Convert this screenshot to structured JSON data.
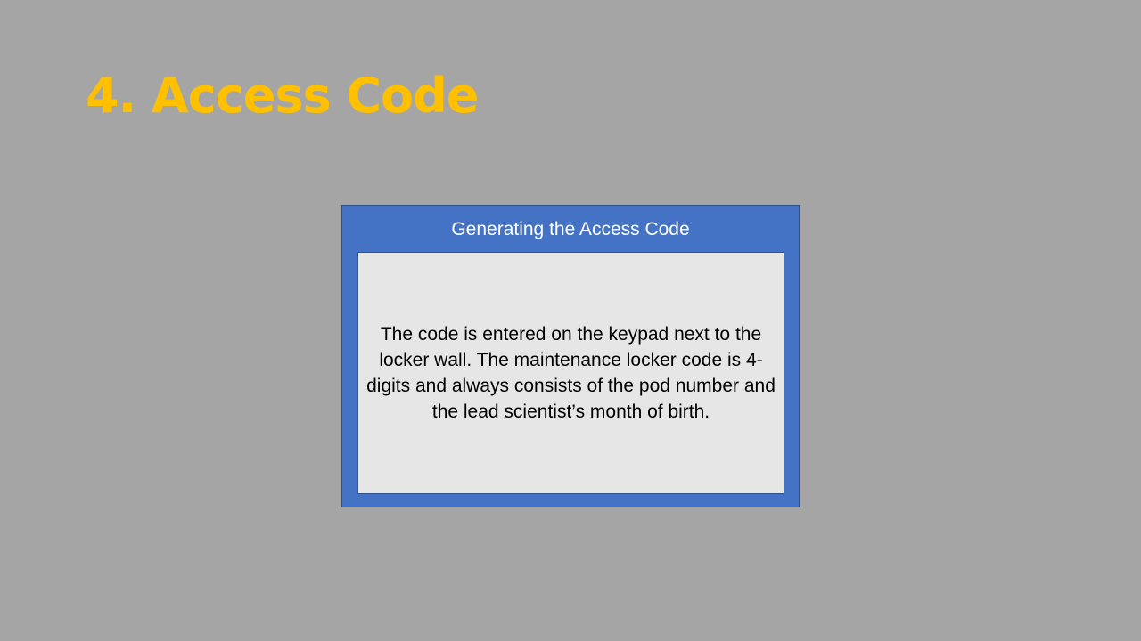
{
  "slide": {
    "title": "4. Access Code",
    "background_color": "#A5A5A5",
    "title_color": "#FFC000"
  },
  "card": {
    "header": "Generating the Access Code",
    "body": "The code is entered on the keypad next to the locker wall. The maintenance locker code is 4-digits and always consists of the pod number and the lead scientist’s month of birth.",
    "header_background_color": "#4472C4",
    "body_background_color": "#E6E6E6"
  }
}
